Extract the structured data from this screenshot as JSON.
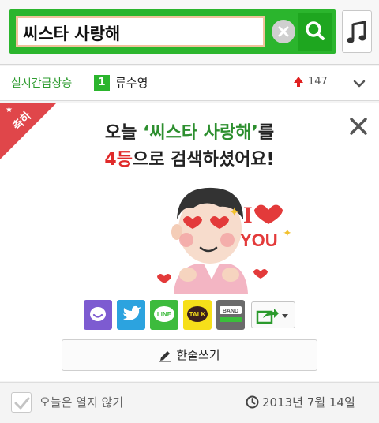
{
  "search": {
    "query": "씨스타 사랑해"
  },
  "ranking": {
    "title": "실시간급상승",
    "position": "1",
    "keyword": "류수영",
    "count": "147"
  },
  "popup": {
    "ribbon_label": "축하",
    "headline_prefix": "오늘 ",
    "headline_keyword": "‘씨스타 사랑해’",
    "headline_suffix_line1": "를",
    "headline_rank": "4등",
    "headline_suffix_line2": "으로 검색하셨어요!",
    "sticker_text_top": "I",
    "sticker_text_bottom": "YOU",
    "share_buttons": [
      "comment",
      "twitter",
      "LINE",
      "TALK",
      "BAND",
      "more"
    ],
    "share_line_label": "LINE",
    "share_talk_label": "TALK",
    "share_band_label": "BAND",
    "write_label": "한줄쓰기"
  },
  "footer": {
    "dont_open_label": "오늘은 열지 않기",
    "date": "2013년 7월 14일"
  },
  "colors": {
    "brand_green": "#2bb52d",
    "accent_red": "#e02a2a"
  }
}
